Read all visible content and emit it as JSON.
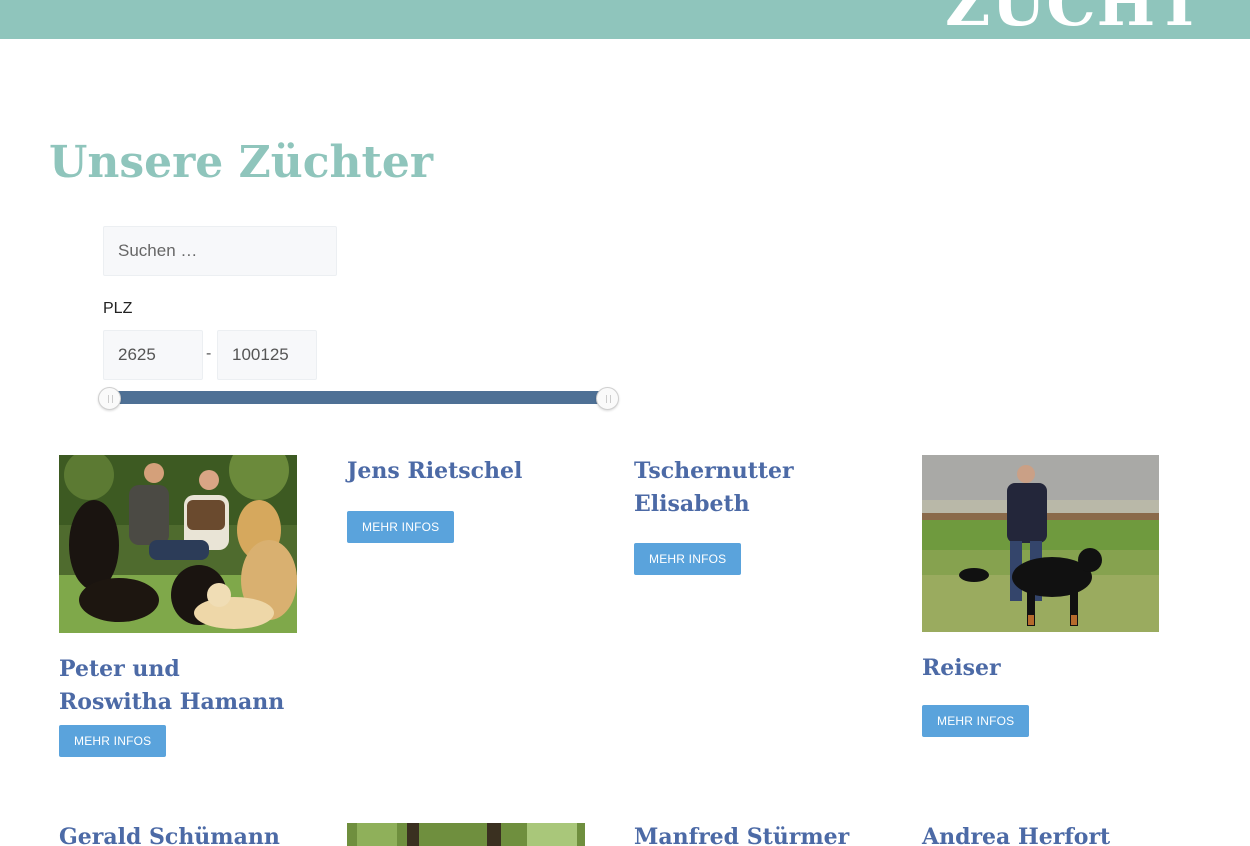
{
  "header": {
    "title": "ZUCHT"
  },
  "page": {
    "title": "Unsere Züchter"
  },
  "search": {
    "placeholder": "Suchen …"
  },
  "plz": {
    "label": "PLZ",
    "min": "2625",
    "max": "100125",
    "separator": "-",
    "range_fill": 1.0
  },
  "colors": {
    "accent": "#8fc5bc",
    "name": "#4c6aa6",
    "button": "#5aa3dc",
    "slider": "#4e7095"
  },
  "breeders": [
    {
      "name": "Peter und Roswitha Hamann",
      "button": "MEHR INFOS",
      "has_photo": true
    },
    {
      "name": "Jens Rietschel",
      "button": "MEHR INFOS",
      "has_photo": false
    },
    {
      "name": "Tschernutter Elisabeth",
      "button": "MEHR INFOS",
      "has_photo": false
    },
    {
      "name": "Reiser",
      "button": "MEHR INFOS",
      "has_photo": true
    },
    {
      "name": "Gerald Schümann",
      "has_photo": false
    },
    {
      "name": "",
      "has_photo": true
    },
    {
      "name": "Manfred Stürmer",
      "has_photo": false
    },
    {
      "name": "Andrea Herfort",
      "has_photo": false
    }
  ]
}
